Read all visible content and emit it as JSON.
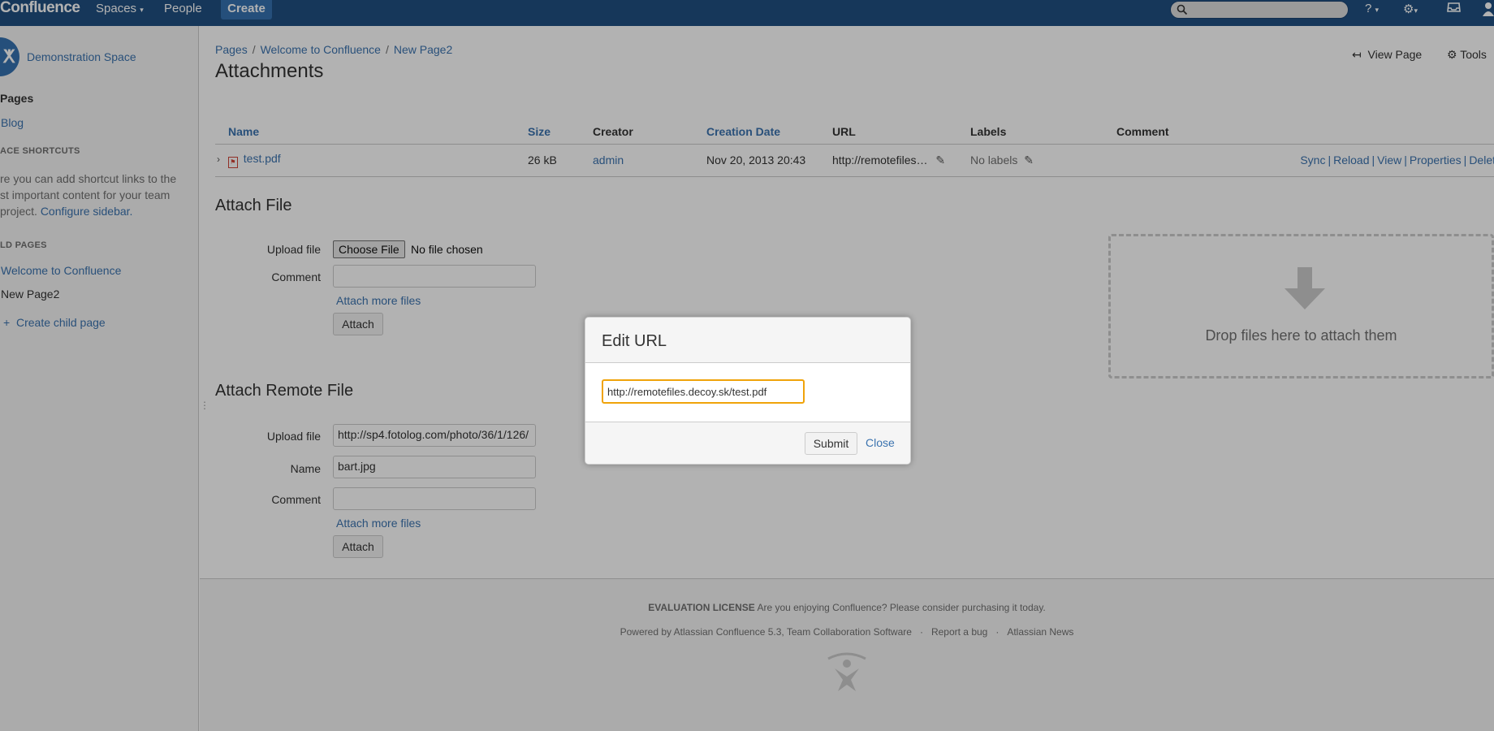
{
  "header": {
    "logo": "Confluence",
    "nav": [
      "Spaces",
      "People"
    ],
    "create_label": "Create"
  },
  "sidebar": {
    "space_name": "Demonstration Space",
    "pages_label": "Pages",
    "blog_label": "Blog",
    "shortcuts_heading": "ACE SHORTCUTS",
    "shortcuts_text_lines": [
      "re you can add shortcut links to the",
      "st important content for your team",
      "project."
    ],
    "configure_link": "Configure sidebar.",
    "child_heading": "LD PAGES",
    "children": [
      "Welcome to Confluence",
      "New Page2"
    ],
    "create_child": "Create child page"
  },
  "breadcrumbs": [
    "Pages",
    "Welcome to Confluence",
    "New Page2"
  ],
  "page_title": "Attachments",
  "page_actions": {
    "view": "View Page",
    "tools": "Tools"
  },
  "table": {
    "columns": [
      "Name",
      "Size",
      "Creator",
      "Creation Date",
      "URL",
      "Labels",
      "Comment"
    ],
    "rows": [
      {
        "name": "test.pdf",
        "size": "26 kB",
        "creator": "admin",
        "date": "Nov 20, 2013 20:43",
        "url": "http://remotefiles…",
        "labels": "No labels",
        "comment": "",
        "actions": [
          "Sync",
          "Reload",
          "View",
          "Properties",
          "Delet"
        ]
      }
    ]
  },
  "attach_file": {
    "heading": "Attach File",
    "upload_label": "Upload file",
    "choose_label": "Choose File",
    "no_file": "No file chosen",
    "comment_label": "Comment",
    "more_files": "Attach more files",
    "attach_button": "Attach"
  },
  "dropzone_text": "Drop files here to attach them",
  "attach_remote": {
    "heading": "Attach Remote File",
    "upload_label": "Upload file",
    "upload_value": "http://sp4.fotolog.com/photo/36/1/126/",
    "name_label": "Name",
    "name_value": "bart.jpg",
    "comment_label": "Comment",
    "more_files": "Attach more files",
    "attach_button": "Attach"
  },
  "footer": {
    "license_bold": "EVALUATION LICENSE",
    "license_text": "Are you enjoying Confluence? Please consider purchasing it today.",
    "powered": "Powered by Atlassian Confluence 5.3, Team Collaboration Software",
    "report": "Report a bug",
    "news": "Atlassian News"
  },
  "dialog": {
    "title": "Edit URL",
    "url_value": "http://remotefiles.decoy.sk/test.pdf",
    "submit": "Submit",
    "close": "Close"
  },
  "colors": {
    "header_bg": "#205081",
    "link": "#3b73af",
    "focus": "#f0a30a"
  }
}
